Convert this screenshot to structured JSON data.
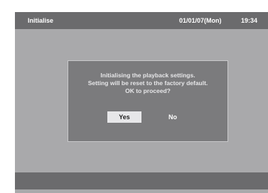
{
  "header": {
    "title": "Initialise",
    "date": "01/01/07(Mon)",
    "time": "19:34"
  },
  "dialog": {
    "lines": [
      "Initialising the playback settings.",
      "Setting will be reset to the factory default.",
      "OK to proceed?"
    ],
    "yes_label": "Yes",
    "no_label": "No",
    "selected": "Yes"
  },
  "colors": {
    "background": "#a9a9ab",
    "bar": "#6b6b6d",
    "dialog": "#7b7b7d",
    "highlight": "#e7e7e9"
  }
}
